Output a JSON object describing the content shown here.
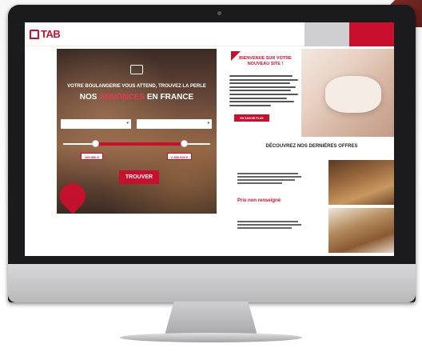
{
  "header": {
    "logo": "TAB",
    "logo_sub": "",
    "nav": [
      "",
      "",
      "",
      ""
    ],
    "btn_grey": "",
    "btn_red": ""
  },
  "hero": {
    "subtitle": "VOTRE BOULANGERIE VOUS ATTEND, TROUVEZ LA PERLE",
    "title_pre": "NOS ",
    "title_highlight": "ANNONCES",
    "title_post": " EN FRANCE",
    "select1": "",
    "select2": "",
    "range_label": "",
    "min_price": "100 000 €",
    "max_price": "2 350 000 €",
    "search_button": "TROUVER",
    "pin_label": "",
    "range_fill": {
      "min_fraction": 0.22,
      "max_fraction": 0.82
    }
  },
  "welcome": {
    "title": "BIENVENUE SUR VOTRE NOUVEAU SITE !",
    "subtitle": "",
    "discover_button": "EN SAVOIR PLUS"
  },
  "offers": {
    "title": "DÉCOUVREZ NOS DERNIÈRES OFFRES",
    "items": [
      {
        "category": "",
        "price": "Prix non renseigné"
      },
      {
        "category": "",
        "price": ""
      }
    ]
  },
  "colors": {
    "accent": "#c8102e",
    "bezel": "#1b1b1d"
  }
}
